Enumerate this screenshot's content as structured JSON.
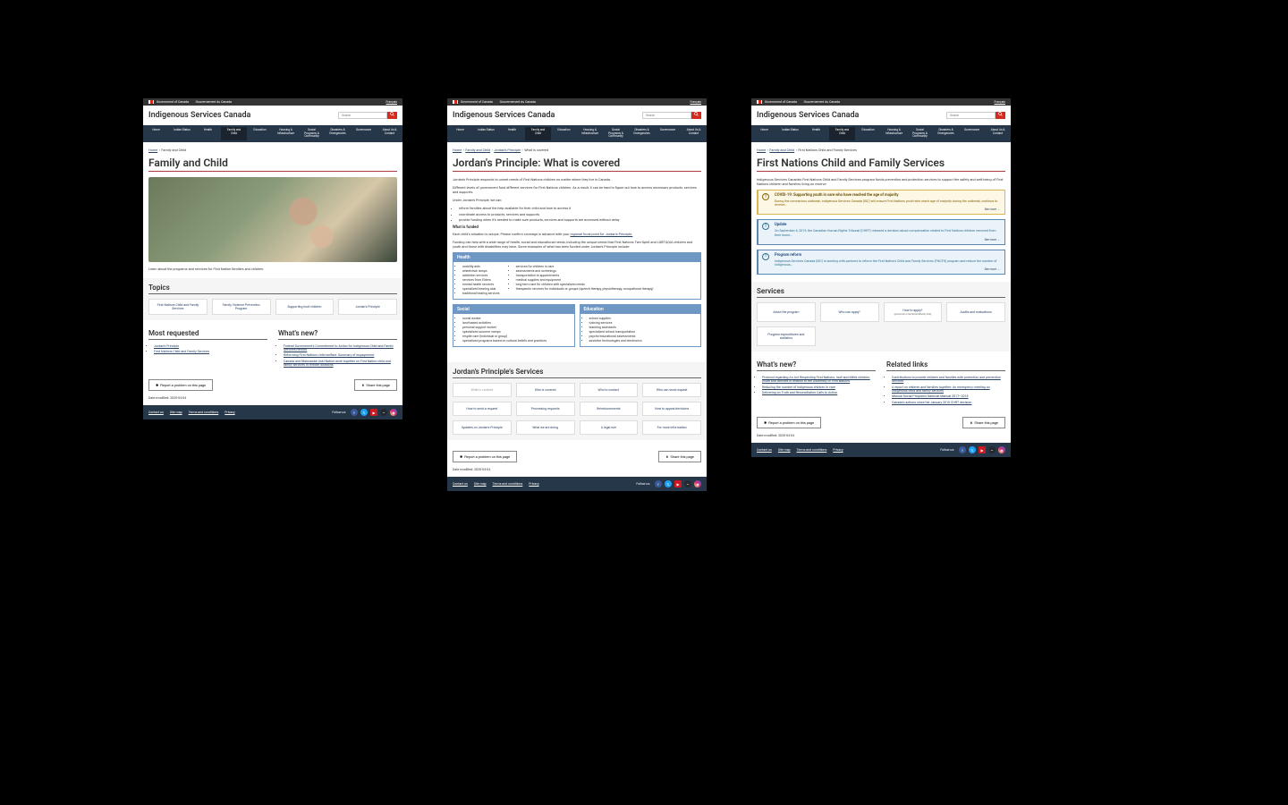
{
  "common": {
    "gov_en": "Government of Canada",
    "gov_fr": "Gouvernement du Canada",
    "lang_link": "Français",
    "site_title": "Indigenous Services Canada",
    "search_placeholder": "Search",
    "nav": [
      "Home",
      "Indian Status",
      "Health",
      "Family and Child",
      "Education",
      "Housing & Infrastructure",
      "Social Programs & Community",
      "Disasters & Emergencies",
      "Governance",
      "About Us & Contact"
    ],
    "nav_active_index": 3,
    "report_btn": "Report a problem on this page",
    "share_btn": "Share this page",
    "date_modified": "Date modified: 2020-04-04",
    "footer_links": [
      "Contact us",
      "Site map",
      "Terms and conditions",
      "Privacy"
    ],
    "follow_us": "Follow us:"
  },
  "page1": {
    "breadcrumb": {
      "links": [
        "Home"
      ],
      "current": "Family and Child"
    },
    "title": "Family and Child",
    "intro": "Learn about the programs and services for First Nation families and children.",
    "topics_h": "Topics",
    "topics": [
      "First Nations Child and Family Services",
      "Family Violence Prevention Program",
      "Supporting Inuit children",
      "Jordan's Principle"
    ],
    "most_requested_h": "Most requested",
    "most_requested": [
      "Jordan's Principle",
      "First Nations Child and Family Services"
    ],
    "whats_new_h": "What's new?",
    "whats_new": [
      "Federal Government's Commitment to Action for Indigenous Child and Family Services Reform",
      "Reforming First Nations child welfare: Summary of engagement",
      "Canada and Nishnawbe Aski Nation work together on First Nation child and family services in remote locations"
    ]
  },
  "page2": {
    "breadcrumb": {
      "links": [
        "Home",
        "Family and Child",
        "Jordan's Principle"
      ],
      "current": "What is covered"
    },
    "title": "Jordan's Principle: What is covered",
    "para1": "Jordan's Principle responds to unmet needs of First Nations children no matter where they live in Canada.",
    "para2": "Different levels of government fund different services for First Nations children. As a result, it can be hard to figure out how to access necessary products, services and supports.",
    "para3": "Under Jordan's Principle, we can:",
    "list1": [
      "inform families about the help available for their child and how to access it",
      "coordinate access to products, services and supports",
      "provide funding when it's needed to make sure products, services and supports are accessed without delay"
    ],
    "funded_h": "What is funded",
    "funded_p1": "Each child's situation is unique. Please confirm coverage in advance with your ",
    "funded_link": "regional focal point for Jordan's Principle.",
    "funded_p2": "Funding can help with a wide range of health, social and educational needs, including the unique needs that First Nations Two-Spirit and LGBTQQIA children and youth and those with disabilities may have. Some examples of what has been funded under Jordan's Principle include:",
    "boxes": {
      "health": {
        "title": "Health",
        "col1": [
          "mobility aids",
          "wheelchair ramps",
          "addiction services",
          "services from Elders",
          "mental health services",
          "specialized hearing aids",
          "traditional healing services"
        ],
        "col2": [
          "services for children in care",
          "assessments and screenings",
          "transportation to appointments",
          "medical supplies and equipment",
          "long-term care for children with specialized needs",
          "therapeutic services for individuals or groups (speech therapy, physiotherapy, occupational therapy)"
        ]
      },
      "social": {
        "title": "Social",
        "items": [
          "social worker",
          "land-based activities",
          "personal support worker",
          "specialized summer camps",
          "respite care (individual or group)",
          "specialized programs based on cultural beliefs and practices"
        ]
      },
      "education": {
        "title": "Education",
        "items": [
          "school supplies",
          "tutoring services",
          "teaching assistants",
          "specialized school transportation",
          "psycho-educational assessments",
          "assistive technologies and electronics"
        ]
      }
    },
    "services_h": "Jordan's Principle's Services",
    "services": [
      {
        "label": "What is covered",
        "disabled": true
      },
      {
        "label": "Who is covered"
      },
      {
        "label": "Who to contact"
      },
      {
        "label": "Who can send request"
      },
      {
        "label": "How to send a request"
      },
      {
        "label": "Processing requests"
      },
      {
        "label": "Reimbursements"
      },
      {
        "label": "How to appeal decisions"
      },
      {
        "label": "Updates on Jordan's Principle"
      },
      {
        "label": "What we are doing"
      },
      {
        "label": "A legal rule"
      },
      {
        "label": "For more information"
      }
    ]
  },
  "page3": {
    "breadcrumb": {
      "links": [
        "Home",
        "Family and Child"
      ],
      "current": "First Nations Child and Family Services"
    },
    "title": "First Nations Child and Family Services",
    "intro": "Indigenous Services Canada's First Nations Child and Family Services program funds prevention and protection services to support the safety and well-being of First Nations children and families living on reserve.",
    "alerts": [
      {
        "kind": "warn",
        "title": "COVID-19: Supporting youth in care who have reached the age of majority",
        "body": "During the coronavirus outbreak, Indigenous Services Canada (ISC) will ensure First Nations youth who reach age of majority during the outbreak, continue to receive…",
        "more": "See more →"
      },
      {
        "kind": "info",
        "title": "Update",
        "body": "On September 6, 2019, the Canadian Human Rights Tribunal (CHRT) released a decision about compensation related to First Nations children removed from their home…",
        "more": "See more →"
      },
      {
        "kind": "info",
        "title": "Program reform",
        "body": "Indigenous Services Canada (ISC) is working with partners to reform the First Nations Child and Family Services (FNCFS) program and reduce the number of Indigenous…",
        "more": "See more →"
      }
    ],
    "services_h": "Services",
    "services": [
      {
        "label": "About the program"
      },
      {
        "label": "Who can apply?"
      },
      {
        "label": "How to apply?",
        "sub": "(provincial or territorial Ministry link)"
      },
      {
        "label": "Audits and evaluations"
      },
      {
        "label": "Program expenditures and statistics"
      }
    ],
    "whats_new_h": "What's new?",
    "whats_new": [
      "Protocol regarding An Act Respecting First Nations, Inuit and Métis children, youth and families in relation to the Assembly of First Nations",
      "Reducing the number of Indigenous children in care",
      "Delivering on Truth and Reconciliation Calls to Action"
    ],
    "related_h": "Related links",
    "related": [
      "Contributions to provide children and families with protection and prevention services",
      "A report on children and families together: An emergency meeting on Indigenous child and family services",
      "Manual Social Programs National Manual 2017–2018",
      "Canada's actions since the January 2016 CHRT decision"
    ]
  }
}
